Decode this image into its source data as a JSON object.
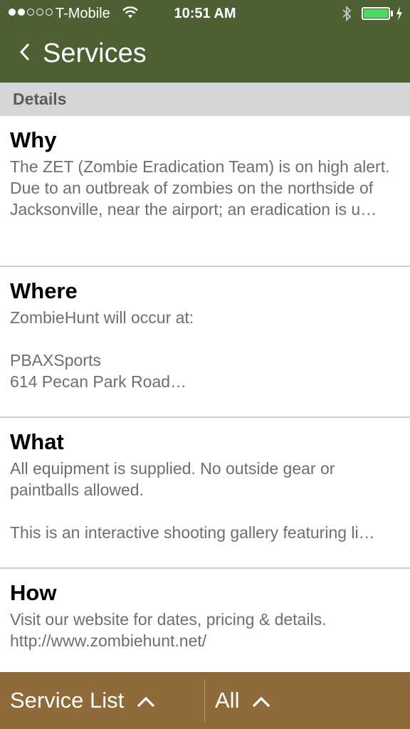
{
  "status_bar": {
    "signal_filled": 2,
    "signal_total": 5,
    "carrier": "T-Mobile",
    "time": "10:51 AM",
    "battery_level": 1.0,
    "battery_color": "#4cd964"
  },
  "nav": {
    "title": "Services",
    "back_icon": "chevron-left-icon",
    "background": "#4f5f34"
  },
  "section": {
    "header": "Details"
  },
  "rows": [
    {
      "title": "Why",
      "body": "The ZET (Zombie Eradication Team) is on high alert.\nDue to an outbreak of zombies on the northside of Jacksonville, near the airport; an eradication is u…"
    },
    {
      "title": "Where",
      "body": "ZombieHunt will occur at:\n\nPBAXSports\n614 Pecan Park Road…"
    },
    {
      "title": "What",
      "body": "All equipment is supplied. No outside gear or paintballs allowed.\n\nThis is an interactive shooting gallery featuring li…"
    },
    {
      "title": "How",
      "body": "Visit our website for dates, pricing & details.\nhttp://www.zombiehunt.net/"
    }
  ],
  "bottom_bar": {
    "service_list_label": "Service List",
    "all_label": "All",
    "chevron_icon": "chevron-up-icon",
    "background": "#8f6a3a"
  }
}
